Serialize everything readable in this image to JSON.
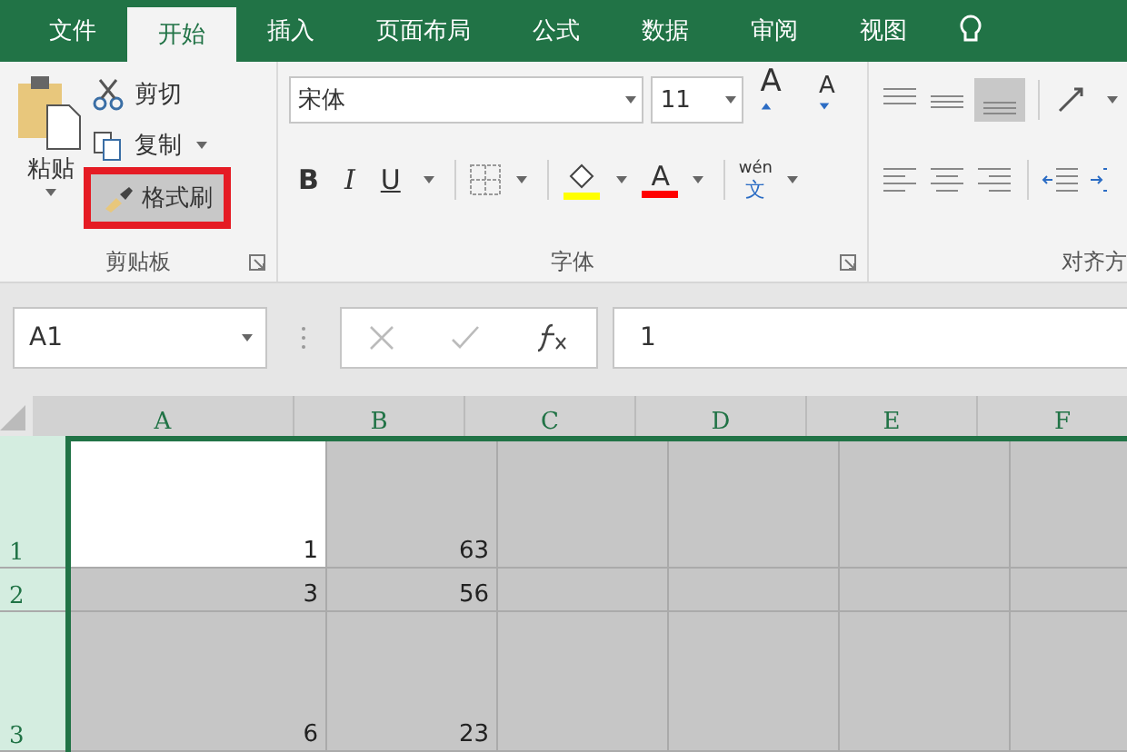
{
  "tabs": [
    {
      "label": "文件",
      "selected": false
    },
    {
      "label": "开始",
      "selected": true
    },
    {
      "label": "插入",
      "selected": false
    },
    {
      "label": "页面布局",
      "selected": false
    },
    {
      "label": "公式",
      "selected": false
    },
    {
      "label": "数据",
      "selected": false
    },
    {
      "label": "审阅",
      "selected": false
    },
    {
      "label": "视图",
      "selected": false
    }
  ],
  "clipboard": {
    "paste": "粘贴",
    "cut": "剪切",
    "copy": "复制",
    "format_painter": {
      "label": "格式刷",
      "highlighted": true
    },
    "group_label": "剪贴板"
  },
  "font": {
    "name": "宋体",
    "size": "11",
    "grow": "A",
    "shrink": "A",
    "bold": "B",
    "italic": "I",
    "underline": "U",
    "fill_color": {
      "color": "#ffff00"
    },
    "font_color": {
      "glyph": "A",
      "color": "#ff0000"
    },
    "phonetic": {
      "top": "wén",
      "bottom": "文"
    },
    "group_label": "字体"
  },
  "alignment": {
    "bottom_align_selected": true,
    "group_label": "对齐方"
  },
  "name_box": "A1",
  "formula": "1",
  "columns": [
    "A",
    "B",
    "C",
    "D",
    "E",
    "F"
  ],
  "rows": [
    {
      "header": "1",
      "selected": true,
      "cells": [
        {
          "text": "1",
          "active": true
        },
        {
          "text": "63",
          "active": false
        }
      ]
    },
    {
      "header": "2",
      "selected": true,
      "cells": [
        {
          "text": "3",
          "active": false
        },
        {
          "text": "56",
          "active": false
        }
      ]
    },
    {
      "header": "3",
      "selected": true,
      "cells": [
        {
          "text": "6",
          "active": false
        },
        {
          "text": "23",
          "active": false
        }
      ]
    }
  ]
}
